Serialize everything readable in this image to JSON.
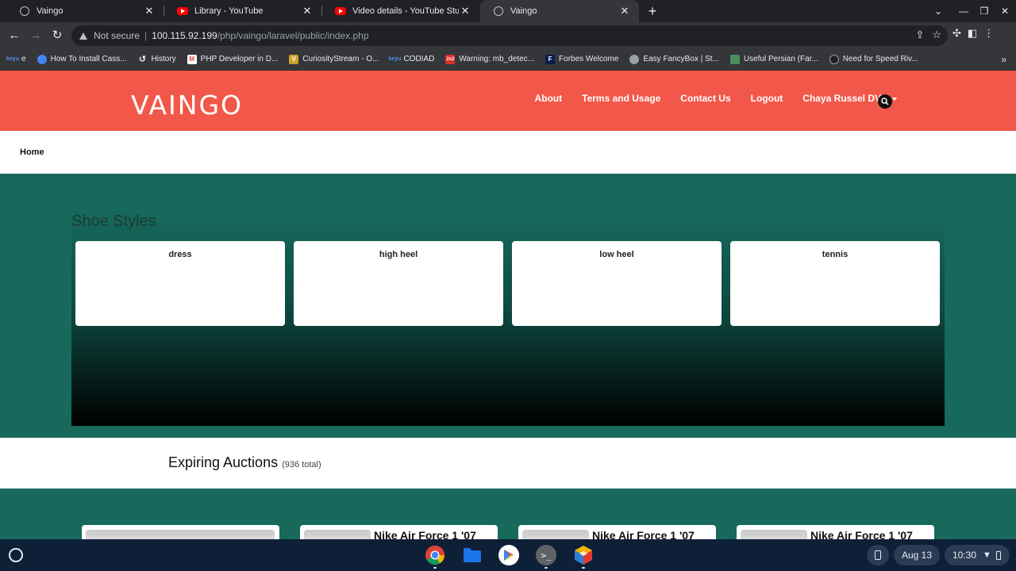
{
  "browser": {
    "tabs": [
      {
        "title": "Vaingo",
        "icon": "globe-icon"
      },
      {
        "title": "Library - YouTube",
        "icon": "youtube-icon"
      },
      {
        "title": "Video details - YouTube Studio",
        "icon": "youtube-icon"
      },
      {
        "title": "Vaingo",
        "icon": "globe-icon"
      }
    ],
    "active_tab": 3,
    "close_glyph": "✕",
    "new_tab_glyph": "+",
    "security_label": "Not secure",
    "separator": "|",
    "url_host": "100.115.92.199",
    "url_path": "/php/vaingo/laravel/public/index.php",
    "bookmarks": [
      {
        "label": "e",
        "icon_text": "keyu",
        "icon_color": "#1a73e8"
      },
      {
        "label": "How To Install Cass...",
        "icon_text": "",
        "icon_color": "#4285f4"
      },
      {
        "label": "History",
        "icon_text": "↺",
        "icon_color": "#35363a"
      },
      {
        "label": "PHP Developer in D...",
        "icon_text": "M",
        "icon_color": "#ea4335"
      },
      {
        "label": "CuriosityStream - O...",
        "icon_text": "V",
        "icon_color": "#c9a227"
      },
      {
        "label": "CODIAD",
        "icon_text": "keyu",
        "icon_color": "#1a73e8"
      },
      {
        "label": "Warning: mb_detec...",
        "icon_text": "2x2",
        "icon_color": "#d93025"
      },
      {
        "label": "Forbes Welcome",
        "icon_text": "F",
        "icon_color": "#0b1c4a"
      },
      {
        "label": "Easy FancyBox | St...",
        "icon_text": "",
        "icon_color": "#9aa0a6"
      },
      {
        "label": "Useful Persian (Far...",
        "icon_text": "",
        "icon_color": "#4a8f5b"
      },
      {
        "label": "Need for Speed Riv...",
        "icon_text": "",
        "icon_color": "#202124"
      }
    ]
  },
  "site": {
    "logo": "VAINGO",
    "nav": {
      "about": "About",
      "terms": "Terms and Usage",
      "contact": "Contact Us",
      "logout": "Logout",
      "user": "Chaya Russel DVM"
    },
    "breadcrumb": "Home",
    "styles_title": "Shoe Styles",
    "styles": [
      "dress",
      "high heel",
      "low heel",
      "tennis"
    ],
    "auctions_title": "Expiring Auctions",
    "auctions_count": "(936 total)",
    "auction_items": [
      "",
      "Nike Air Force 1 '07",
      "Nike Air Force 1 '07",
      "Nike Air Force 1 '07"
    ]
  },
  "shelf": {
    "date": "Aug 13",
    "time": "10:30",
    "apps": [
      "chrome-icon",
      "files-icon",
      "play-store-icon",
      "terminal-icon",
      "netbeans-icon"
    ]
  },
  "colors": {
    "header": "#f25849",
    "teal": "#17695c",
    "shelf": "#0e1f38"
  }
}
